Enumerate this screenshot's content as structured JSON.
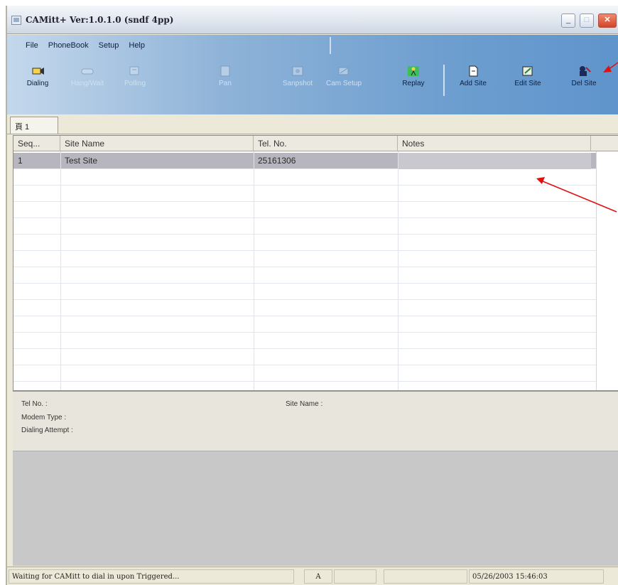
{
  "window": {
    "title": "CAMitt+ Ver:1.0.1.0 (sndf 4pp)",
    "minimize": "_",
    "maximize": "□",
    "close": "✕"
  },
  "menu": {
    "items": [
      "File",
      "PhoneBook",
      "Setup",
      "Help"
    ]
  },
  "toolbar": {
    "buttons": [
      {
        "label": "Dialing",
        "icon": "dialing-icon",
        "enabled": true
      },
      {
        "label": "Hang/Wait",
        "icon": "hangup-icon",
        "enabled": false
      },
      {
        "label": "Polling",
        "icon": "polling-icon",
        "enabled": false
      },
      {
        "label": "Pan",
        "icon": "pan-icon",
        "enabled": false
      },
      {
        "label": "Sanpshot",
        "icon": "snapshot-icon",
        "enabled": false
      },
      {
        "label": "Cam Setup",
        "icon": "cam-setup-icon",
        "enabled": false
      },
      {
        "label": "Replay",
        "icon": "replay-icon",
        "enabled": true
      },
      {
        "label": "Add Site",
        "icon": "add-site-icon",
        "enabled": true
      },
      {
        "label": "Edit Site",
        "icon": "edit-site-icon",
        "enabled": true
      },
      {
        "label": "Del Site",
        "icon": "del-site-icon",
        "enabled": true
      }
    ]
  },
  "tabs": [
    {
      "label": "頁 1"
    }
  ],
  "grid": {
    "columns": [
      "Seq...",
      "Site Name",
      "Tel. No.",
      "Notes"
    ],
    "rows": [
      {
        "seq": "1",
        "site_name": "Test Site",
        "tel": "25161306",
        "notes": ""
      }
    ]
  },
  "info": {
    "tel_no_label": "Tel No. :",
    "site_name_label": "Site Name :",
    "modem_type_label": "Modem Type :",
    "dialing_attempt_label": "Dialing Attempt :"
  },
  "statusbar": {
    "message": "Waiting for CAMitt to dial in upon Triggered...",
    "indicator": "A",
    "datetime": "05/26/2003 15:46:03"
  },
  "colors": {
    "annotation_arrow": "#e01010",
    "selected_row": "#b7b6bf",
    "toolbar_band": "#6f9fd0"
  }
}
